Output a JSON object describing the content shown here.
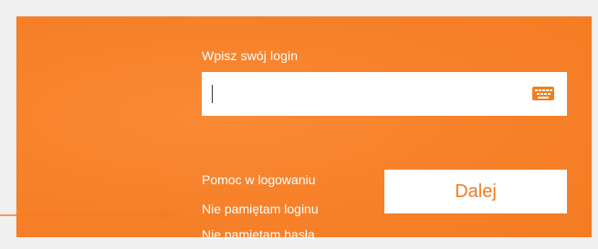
{
  "form": {
    "login_label": "Wpisz swój login",
    "login_value": "",
    "next_button": "Dalej"
  },
  "links": {
    "help": "Pomoc w logowaniu",
    "forgot_login": "Nie pamiętam loginu",
    "forgot_password": "Nie pamiętam hasła"
  },
  "icons": {
    "keyboard": "keyboard-icon",
    "arrow": "arrow-pointer-icon"
  },
  "colors": {
    "panel_orange": "#f7822b",
    "button_text": "#f07a21",
    "arrow": "#f47b22"
  }
}
